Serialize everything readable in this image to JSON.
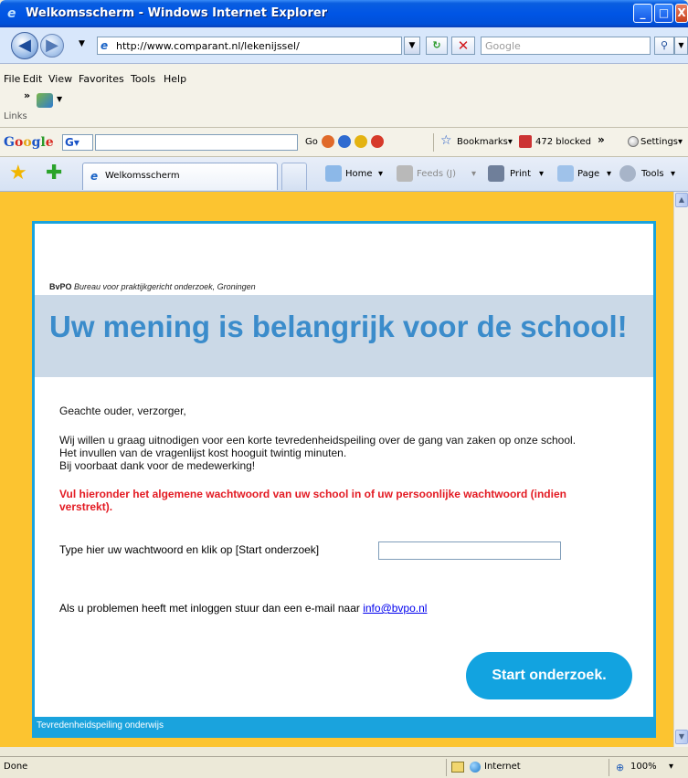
{
  "window": {
    "title": "Welkomsscherm - Windows Internet Explorer"
  },
  "address_bar": {
    "url": "http://www.comparant.nl/lekenijssel/",
    "search_placeholder": "Google"
  },
  "menu": {
    "items": [
      "File",
      "Edit",
      "View",
      "Favorites",
      "Tools",
      "Help"
    ],
    "links_label": "Links"
  },
  "google_toolbar": {
    "logo": "Google",
    "go_label": "Go",
    "bookmarks_label": "Bookmarks▾",
    "blocked_label": "472 blocked",
    "more_label": "»",
    "settings_label": "Settings▾"
  },
  "tabs": {
    "active_tab_label": "Welkomsscherm"
  },
  "command_bar": {
    "home_label": "Home",
    "feeds_label": "Feeds (J)",
    "print_label": "Print",
    "page_label": "Page",
    "tools_label": "Tools"
  },
  "page": {
    "org_short": "BvPO",
    "org_full": "Bureau voor praktijkgericht onderzoek, Groningen",
    "headline": "Uw mening is belangrijk voor de school!",
    "greeting": "Geachte ouder, verzorger,",
    "intro_line1": "Wij willen u graag uitnodigen voor een korte tevredenheidspeiling over de gang van zaken op onze school.",
    "intro_line2": "Het invullen van de vragenlijst kost hooguit twintig minuten.",
    "intro_line3": "Bij voorbaat dank voor de medewerking!",
    "notice": "Vul hieronder het algemene wachtwoord van uw school in of uw persoonlijke wachtwoord (indien verstrekt).",
    "password_label": "Type hier uw wachtwoord en klik op [Start onderzoek]",
    "password_value": "",
    "help_text": "Als u problemen heeft met inloggen stuur dan een e-mail naar",
    "help_email": "info@bvpo.nl",
    "start_button": "Start onderzoek.",
    "footer": "Tevredenheidspeiling onderwijs"
  },
  "status_bar": {
    "status": "Done",
    "zone": "Internet",
    "zoom": "100%"
  },
  "colors": {
    "page_background": "#fcc430",
    "accent_blue": "#1aa3dd",
    "headline_blue": "#3b8ccb",
    "hero_band": "#cbd9e7",
    "notice_red": "#e31b23"
  }
}
